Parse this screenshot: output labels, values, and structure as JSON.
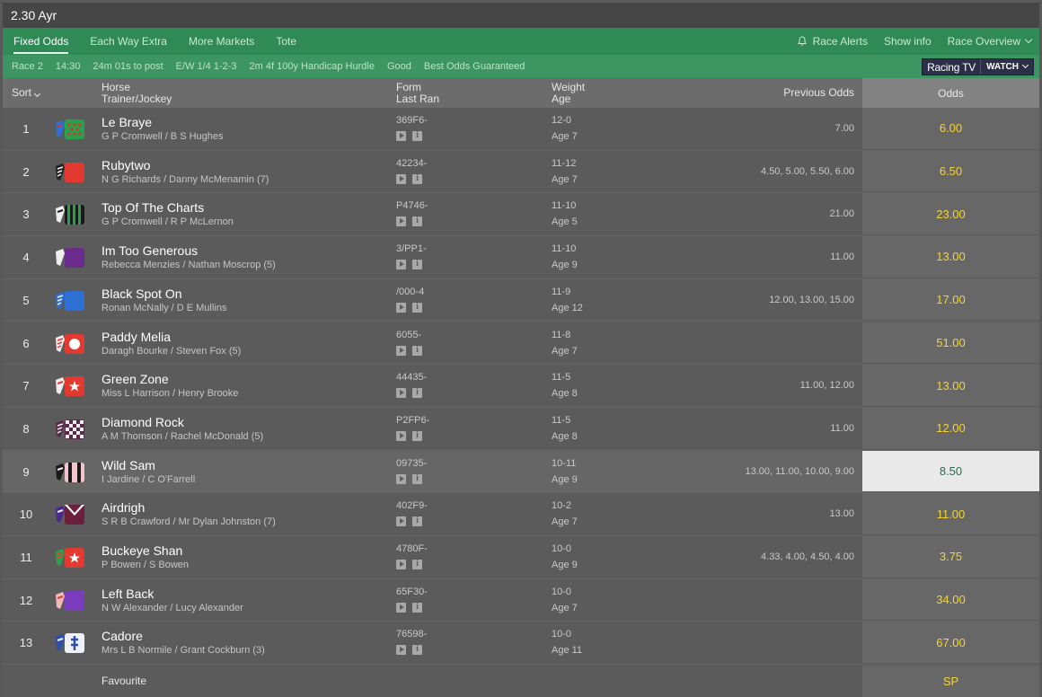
{
  "title": "2.30 Ayr",
  "tabs": [
    {
      "label": "Fixed Odds"
    },
    {
      "label": "Each Way Extra"
    },
    {
      "label": "More Markets"
    },
    {
      "label": "Tote"
    }
  ],
  "right_links": {
    "alerts": "Race Alerts",
    "show_info": "Show info",
    "overview": "Race Overview"
  },
  "info": {
    "race": "Race 2",
    "time": "14:30",
    "countdown": "24m 01s to post",
    "each_way": "E/W 1/4 1-2-3",
    "description": "2m 4f 100y Handicap Hurdle",
    "going": "Good",
    "guarantee": "Best Odds Guaranteed",
    "rtv_logo": "Racing TV",
    "rtv_watch": "WATCH"
  },
  "columns": {
    "sort": "Sort",
    "horse": "Horse",
    "trainer_jockey": "Trainer/Jockey",
    "form": "Form",
    "last_ran": "Last Ran",
    "weight": "Weight",
    "age": "Age",
    "previous_odds": "Previous Odds",
    "odds": "Odds"
  },
  "runners": [
    {
      "num": "1",
      "name": "Le Braye",
      "tj": "G P Cromwell / B S Hughes",
      "form": "369F6-",
      "weight": "12-0",
      "age": "Age 7",
      "prev": "7.00",
      "odds": "6.00"
    },
    {
      "num": "2",
      "name": "Rubytwo",
      "tj": "N G Richards / Danny McMenamin (7)",
      "form": "42234-",
      "weight": "11-12",
      "age": "Age 7",
      "prev": "4.50, 5.00, 5.50, 6.00",
      "odds": "6.50"
    },
    {
      "num": "3",
      "name": "Top Of The Charts",
      "tj": "G P Cromwell / R P McLernon",
      "form": "P4746-",
      "weight": "11-10",
      "age": "Age 5",
      "prev": "21.00",
      "odds": "23.00"
    },
    {
      "num": "4",
      "name": "Im Too Generous",
      "tj": "Rebecca Menzies / Nathan Moscrop (5)",
      "form": "3/PP1-",
      "weight": "11-10",
      "age": "Age 9",
      "prev": "11.00",
      "odds": "13.00"
    },
    {
      "num": "5",
      "name": "Black Spot On",
      "tj": "Ronan McNally / D E Mullins",
      "form": "/000-4",
      "weight": "11-9",
      "age": "Age 12",
      "prev": "12.00, 13.00, 15.00",
      "odds": "17.00"
    },
    {
      "num": "6",
      "name": "Paddy Melia",
      "tj": "Daragh Bourke / Steven Fox (5)",
      "form": "6055-",
      "weight": "11-8",
      "age": "Age 7",
      "prev": "",
      "odds": "51.00"
    },
    {
      "num": "7",
      "name": "Green Zone",
      "tj": "Miss L Harrison / Henry Brooke",
      "form": "44435-",
      "weight": "11-5",
      "age": "Age 8",
      "prev": "11.00, 12.00",
      "odds": "13.00"
    },
    {
      "num": "8",
      "name": "Diamond Rock",
      "tj": "A M Thomson / Rachel McDonald (5)",
      "form": "P2FP6-",
      "weight": "11-5",
      "age": "Age 8",
      "prev": "11.00",
      "odds": "12.00"
    },
    {
      "num": "9",
      "name": "Wild Sam",
      "tj": "I Jardine / C O'Farrell",
      "form": "09735-",
      "weight": "10-11",
      "age": "Age 9",
      "prev": "13.00, 11.00, 10.00, 9.00",
      "odds": "8.50"
    },
    {
      "num": "10",
      "name": "Airdrigh",
      "tj": "S R B Crawford / Mr Dylan Johnston (7)",
      "form": "402F9-",
      "weight": "10-2",
      "age": "Age 7",
      "prev": "13.00",
      "odds": "11.00"
    },
    {
      "num": "11",
      "name": "Buckeye Shan",
      "tj": "P Bowen / S Bowen",
      "form": "4780F-",
      "weight": "10-0",
      "age": "Age 9",
      "prev": "4.33, 4.00, 4.50, 4.00",
      "odds": "3.75"
    },
    {
      "num": "12",
      "name": "Left Back",
      "tj": "N W Alexander / Lucy Alexander",
      "form": "65F30-",
      "weight": "10-0",
      "age": "Age 7",
      "prev": "",
      "odds": "34.00"
    },
    {
      "num": "13",
      "name": "Cadore",
      "tj": "Mrs L B Normile / Grant Cockburn (3)",
      "form": "76598-",
      "weight": "10-0",
      "age": "Age 11",
      "prev": "",
      "odds": "67.00"
    }
  ],
  "favourite": {
    "label": "Favourite",
    "odds": "SP"
  },
  "colors": {
    "tab_bar": "#2f8a55",
    "info_bar": "#3d9661",
    "odds_text": "#f5d535",
    "selected_odds_bg": "#e9e9e9",
    "selected_odds_text": "#2d6a4a"
  }
}
